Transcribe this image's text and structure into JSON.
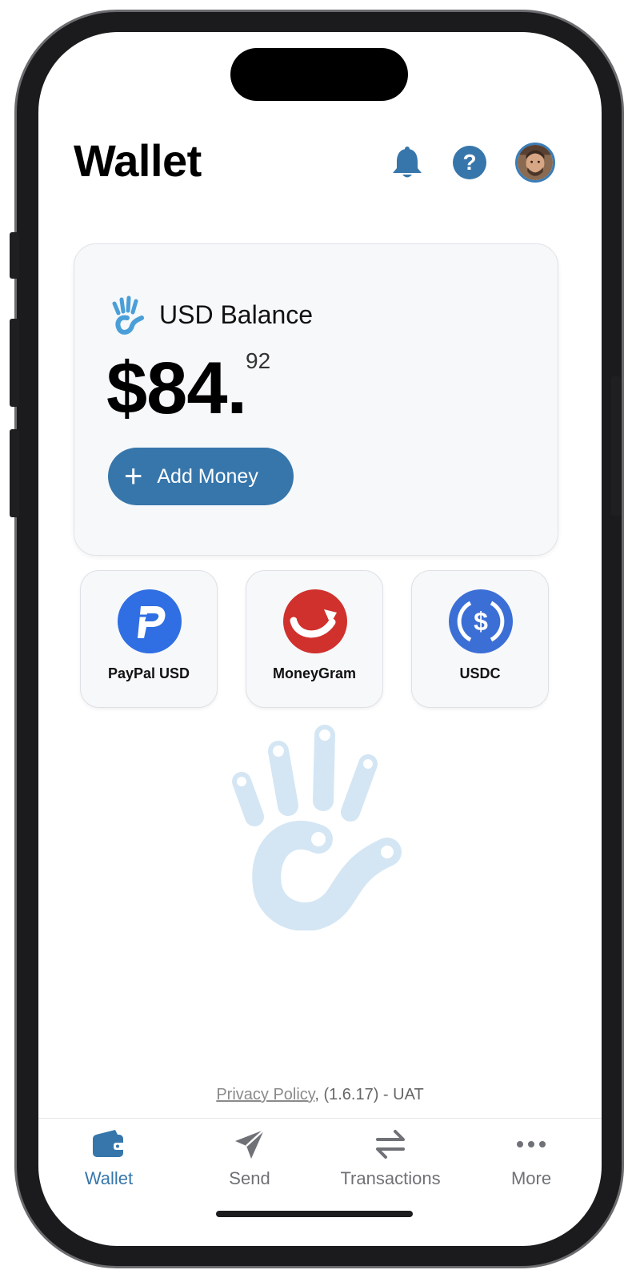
{
  "header": {
    "title": "Wallet"
  },
  "balance": {
    "label": "USD Balance",
    "amount_main": "$84.",
    "amount_cents": "92",
    "add_money_label": "Add Money"
  },
  "methods": [
    {
      "label": "PayPal USD",
      "icon": "paypal-usd-icon"
    },
    {
      "label": "MoneyGram",
      "icon": "moneygram-icon"
    },
    {
      "label": "USDC",
      "icon": "usdc-icon"
    }
  ],
  "footer": {
    "privacy_label": "Privacy Policy",
    "version_text": ", (1.6.17)  -  UAT"
  },
  "tabs": [
    {
      "label": "Wallet",
      "icon": "wallet-icon",
      "active": true
    },
    {
      "label": "Send",
      "icon": "send-icon",
      "active": false
    },
    {
      "label": "Transactions",
      "icon": "transactions-icon",
      "active": false
    },
    {
      "label": "More",
      "icon": "more-icon",
      "active": false
    }
  ],
  "colors": {
    "accent": "#3776ab",
    "card_bg": "#f6f8fa",
    "paypal": "#2f6fe3",
    "moneygram": "#d0312d",
    "usdc": "#3b6fd6",
    "watermark": "#d4e6f4"
  }
}
